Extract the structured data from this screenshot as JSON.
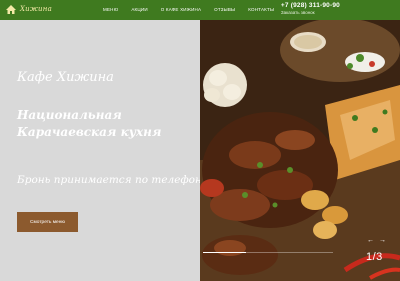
{
  "header": {
    "logo_text": "Хижина",
    "nav": [
      "Меню",
      "Акции",
      "О кафе Хижина",
      "Отзывы",
      "Контакты"
    ],
    "phone": "+7 (928) 311-90-90",
    "callback": "Заказать звонок"
  },
  "hero": {
    "title": "Кафе Хижина",
    "subtitle": "Национальная Карачаевская кухня",
    "note": "Бронь принимается по телефону",
    "button": "Смотреть меню"
  },
  "slider": {
    "prev": "←",
    "next": "→",
    "counter": "1/3",
    "progress": 0.33
  },
  "colors": {
    "header_bg": "#3f7a1f",
    "button_bg": "#8c5a2e",
    "panel_bg": "#d9d9d9"
  },
  "icons": [
    "hut-logo-icon",
    "arrow-left-icon",
    "arrow-right-icon"
  ]
}
